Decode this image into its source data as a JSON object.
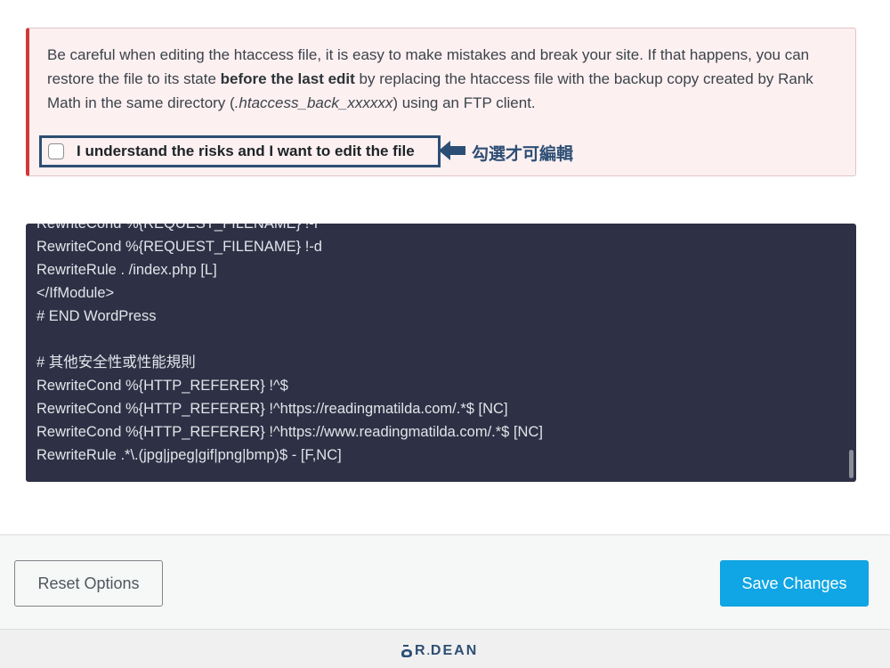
{
  "notice": {
    "text_part1": "Be careful when editing the htaccess file, it is easy to make mistakes and break your site. If that happens, you can restore the file to its state ",
    "text_bold": "before the last edit",
    "text_part2": " by replacing the htaccess file with the backup copy created by Rank Math in the same directory (",
    "text_italic": ".htaccess_back_xxxxxx",
    "text_part3": ") using an FTP client.",
    "checkbox_label": "I understand the risks and I want to edit the file",
    "checkbox_checked": false,
    "annotation": "勾選才可編輯"
  },
  "editor": {
    "lines": [
      "RewriteCond %{REQUEST_FILENAME} !-f",
      "RewriteCond %{REQUEST_FILENAME} !-d",
      "RewriteRule . /index.php [L]",
      "</IfModule>",
      "# END WordPress",
      "",
      "# 其他安全性或性能規則",
      "RewriteCond %{HTTP_REFERER} !^$",
      "RewriteCond %{HTTP_REFERER} !^https://readingmatilda.com/.*$ [NC]",
      "RewriteCond %{HTTP_REFERER} !^https://www.readingmatilda.com/.*$ [NC]",
      "RewriteRule .*\\.(jpg|jpeg|gif|png|bmp)$ - [F,NC]"
    ]
  },
  "footer": {
    "reset_label": "Reset Options",
    "save_label": "Save Changes"
  },
  "brand": {
    "letter": "R",
    "dot": ".",
    "name": "DEAN"
  },
  "colors": {
    "notice_border": "#d63638",
    "notice_bg": "#fcf0f1",
    "annotation": "#2d4e74",
    "editor_bg": "#2e3145",
    "save_button": "#10a5e4"
  },
  "icons": {
    "annotation_arrow": "arrow-left-icon",
    "brand_logo": "dr-dean-logo-icon"
  }
}
